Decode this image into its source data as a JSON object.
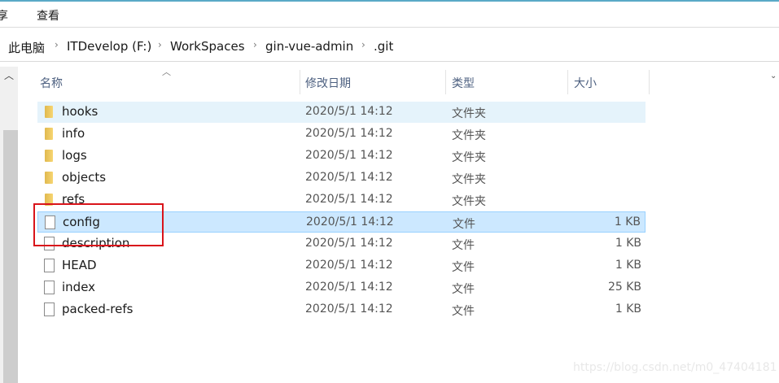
{
  "menu": {
    "share": "享",
    "view": "查看"
  },
  "breadcrumb": [
    "此电脑",
    "ITDevelop (F:)",
    "WorkSpaces",
    "gin-vue-admin",
    ".git"
  ],
  "columns": {
    "name": "名称",
    "date": "修改日期",
    "type": "类型",
    "size": "大小"
  },
  "rows": [
    {
      "name": "hooks",
      "date": "2020/5/1 14:12",
      "type": "文件夹",
      "size": "",
      "kind": "folder"
    },
    {
      "name": "info",
      "date": "2020/5/1 14:12",
      "type": "文件夹",
      "size": "",
      "kind": "folder"
    },
    {
      "name": "logs",
      "date": "2020/5/1 14:12",
      "type": "文件夹",
      "size": "",
      "kind": "folder"
    },
    {
      "name": "objects",
      "date": "2020/5/1 14:12",
      "type": "文件夹",
      "size": "",
      "kind": "folder"
    },
    {
      "name": "refs",
      "date": "2020/5/1 14:12",
      "type": "文件夹",
      "size": "",
      "kind": "folder"
    },
    {
      "name": "config",
      "date": "2020/5/1 14:12",
      "type": "文件",
      "size": "1 KB",
      "kind": "file"
    },
    {
      "name": "description",
      "date": "2020/5/1 14:12",
      "type": "文件",
      "size": "1 KB",
      "kind": "file"
    },
    {
      "name": "HEAD",
      "date": "2020/5/1 14:12",
      "type": "文件",
      "size": "1 KB",
      "kind": "file"
    },
    {
      "name": "index",
      "date": "2020/5/1 14:12",
      "type": "文件",
      "size": "25 KB",
      "kind": "file"
    },
    {
      "name": "packed-refs",
      "date": "2020/5/1 14:12",
      "type": "文件",
      "size": "1 KB",
      "kind": "file"
    }
  ],
  "watermark": "https://blog.csdn.net/m0_47404181",
  "colors": {
    "selected": "#cce8ff",
    "hover": "#e5f3fb",
    "highlight_box": "#d9141b"
  }
}
